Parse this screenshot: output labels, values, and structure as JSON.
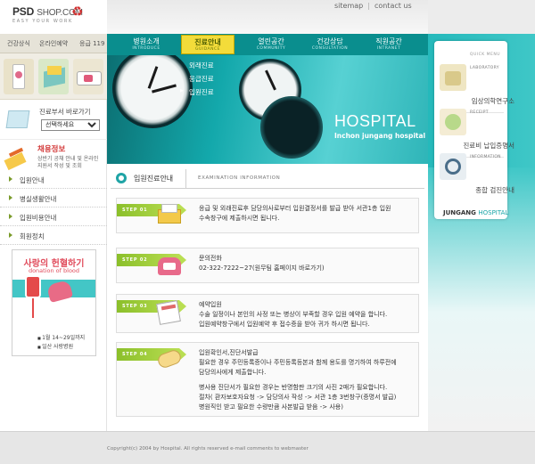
{
  "logo": {
    "name": "PSD",
    "shop": "SHOP.COM",
    "tagline": "EASY YOUR WORK"
  },
  "util_nav": {
    "sitemap": "sitemap",
    "separator": "|",
    "contact": "contact us"
  },
  "quick_tabs": [
    "건강상식",
    "온라인예약",
    "응급 119"
  ],
  "gnb": [
    {
      "ko": "병원소개",
      "en": "INTRODUCE"
    },
    {
      "ko": "진료안내",
      "en": "GUIDANCE",
      "active": true
    },
    {
      "ko": "열린공간",
      "en": "COMMUNITY"
    },
    {
      "ko": "건강상담",
      "en": "CONSULTATION"
    },
    {
      "ko": "직원공간",
      "en": "INTRANET"
    }
  ],
  "submenu": [
    "외래진료",
    "응급진료",
    "입원진료"
  ],
  "hero": {
    "title": "HOSPITAL",
    "subtitle": "Inchon jungang hospital"
  },
  "dept_shortcut": {
    "label": "진료부서 바로가기",
    "select_value": "선택하세요"
  },
  "recruit": {
    "title": "채용정보",
    "desc": "상반기 공채 안내 및 온라인 지원서 작성 및 조회"
  },
  "left_nav": [
    "입원안내",
    "병실생활안내",
    "입원비용안내",
    "회원정치"
  ],
  "blood_banner": {
    "title": "사랑의 헌혈하기",
    "subtitle": "donation of blood",
    "items": [
      "1월 14~29일까지",
      "일산 사랑병원"
    ]
  },
  "quick_menu": {
    "header": "QUICK MENU",
    "items": [
      {
        "en": "LABORATORY",
        "ko": "임상의학연구소"
      },
      {
        "en": "RECEIPT",
        "ko": "진료비 납입증명서"
      },
      {
        "en": "INFORMATION",
        "ko": "종합 검진안내"
      }
    ],
    "brand": "JUNGANG",
    "brand_suffix": "HOSPITAL"
  },
  "section": {
    "title": "입원진료안내",
    "title_en": "EXAMINATION INFORMATION"
  },
  "steps": [
    {
      "tag": "STEP 01",
      "lines": [
        "응급 및 외래진료후 담당의사로부터 입원결정서를 발급 받아 서관1층 입원",
        "수속창구에 제출하시면 됩니다."
      ]
    },
    {
      "tag": "STEP 02",
      "lines": [
        "문의전화",
        "02-322-7222~27(원무팀 홈페이지 바로가기)"
      ]
    },
    {
      "tag": "STEP 03",
      "lines": [
        "예약입원",
        "수술 일정이나 본인의 사정 또는 병상이 부족할 경우 입원 예약을 합니다.",
        "입원예약창구에서 입원예약 후 접수증을 받아 귀가 하시면 됩니다."
      ]
    },
    {
      "tag": "STEP 04",
      "lines": [
        "입원확인서,진단서발급",
        "필요한 경우 주민등록증이나 주민등록등본과 함께 용도를 명기하여 하루전에",
        "담당의사에게 제출합니다.",
        "",
        "병사용 진단서가 필요한 경우는 반명함판 크기의 사진 2매가 필요합니다.",
        "절차( 환자보호자요청 -> 담당의사 작성 -> 서관 1층 3번창구(증명서 발급)",
        "병원직인 받고 필요한 수량만큼 사본발급 받음 -> 사용)"
      ]
    }
  ],
  "footer": {
    "copyright": "Copyright(c) 2004 by Hospital. All rights reserved  e-mail comments to webmaster"
  },
  "colors": {
    "teal": "#0a8e8e",
    "active_menu": "#f3dc3a",
    "step_tag": "#8bbf2a",
    "recruit": "#d33b3b"
  }
}
